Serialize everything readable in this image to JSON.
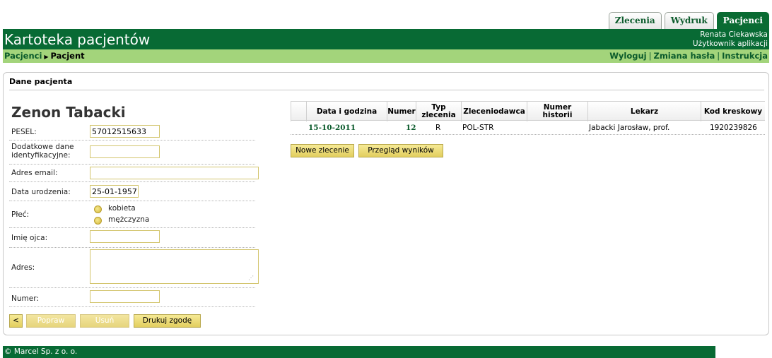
{
  "tabs": [
    {
      "label": "Zlecenia"
    },
    {
      "label": "Wydruk"
    },
    {
      "label": "Pacjenci"
    }
  ],
  "header": {
    "title": "Kartoteka pacjentów",
    "user_name": "Renata Ciekawska",
    "user_role": "Użytkownik aplikacji"
  },
  "breadcrumb": {
    "root": "Pacjenci",
    "current": "Pacjent"
  },
  "top_links": {
    "logout": "Wyloguj",
    "change_password": "Zmiana hasła",
    "manual": "Instrukcja"
  },
  "panel": {
    "title": "Dane pacjenta",
    "patient_name": "Zenon Tabacki"
  },
  "form": {
    "pesel_label": "PESEL:",
    "pesel_value": "57012515633",
    "extra_id_label_1": "Dodatkowe dane",
    "extra_id_label_2": "identyfikacyjne:",
    "extra_id_value": "",
    "email_label": "Adres email:",
    "email_value": "",
    "birthdate_label": "Data urodzenia:",
    "birthdate_value": "25-01-1957",
    "sex_label": "Płeć:",
    "sex_female": "kobieta",
    "sex_male": "mężczyzna",
    "father_label": "Imię ojca:",
    "father_value": "",
    "address_label": "Adres:",
    "address_value": "",
    "number_label": "Numer:",
    "number_value": ""
  },
  "form_buttons": {
    "back": "<",
    "edit": "Popraw",
    "delete": "Usuń",
    "print_consent": "Drukuj zgodę"
  },
  "table": {
    "columns": [
      "Data i godzina",
      "Numer",
      "Typ zlecenia",
      "Zleceniodawca",
      "Numer historii",
      "Lekarz",
      "Kod kreskowy"
    ],
    "col_typ_1": "Typ",
    "col_typ_2": "zlecenia",
    "rows": [
      {
        "date": "15-10-2011",
        "number": "12",
        "type": "R",
        "orderer": "POL-STR",
        "history": "",
        "doctor": "Jabacki Jarosław, prof.",
        "barcode": "1920239826"
      }
    ]
  },
  "table_buttons": {
    "new_order": "Nowe zlecenie",
    "results": "Przegląd wyników"
  },
  "footer": {
    "copyright": "© Marcel Sp. z o. o."
  }
}
